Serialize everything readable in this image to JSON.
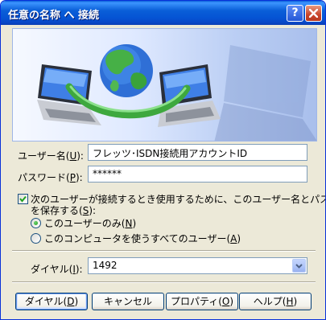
{
  "window": {
    "title": "任意の名称 へ 接続"
  },
  "titlebar": {
    "help_icon": "question-icon",
    "close_icon": "close-icon"
  },
  "banner": {
    "image": "network-connection-illustration"
  },
  "form": {
    "username": {
      "label_prefix": "ユーザー名(",
      "label_key": "U",
      "label_suffix": "):",
      "value": "フレッツ･ISDN接続用アカウントID"
    },
    "password": {
      "label_prefix": "パスワード(",
      "label_key": "P",
      "label_suffix": "):",
      "value": "******"
    },
    "save_checkbox": {
      "checked": true,
      "line1": "次のユーザーが接続するとき使用するために、このユーザー名とパスワード",
      "line2_prefix": "を保存する(",
      "line2_key": "S",
      "line2_suffix": "):"
    },
    "radio_me": {
      "checked": true,
      "prefix": "このユーザーのみ(",
      "key": "N",
      "suffix": ")"
    },
    "radio_all": {
      "checked": false,
      "prefix": "このコンピュータを使うすべてのユーザー(",
      "key": "A",
      "suffix": ")"
    },
    "dial": {
      "label_prefix": "ダイヤル(",
      "label_key": "I",
      "label_suffix": "):",
      "value": "1492"
    }
  },
  "buttons": {
    "dial": {
      "prefix": "ダイヤル(",
      "key": "D",
      "suffix": ")"
    },
    "cancel": {
      "label": "キャンセル"
    },
    "properties": {
      "prefix": "プロパティ(",
      "key": "O",
      "suffix": ")"
    },
    "help": {
      "prefix": "ヘルプ(",
      "key": "H",
      "suffix": ")"
    }
  }
}
